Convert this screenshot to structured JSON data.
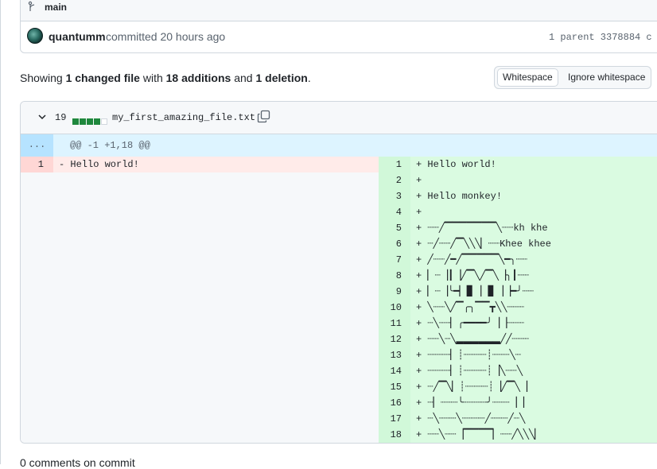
{
  "commit": {
    "branch": "main",
    "author": "quantumm",
    "committed_text": "committed 20 hours ago",
    "parent_info": "1 parent 3378884  c"
  },
  "summary": {
    "prefix": "Showing ",
    "changed": "1 changed file",
    "middle": " with ",
    "additions": "18 additions",
    "and": " and ",
    "deletions": "1 deletion",
    "suffix": "."
  },
  "whitespace": {
    "active_label": "Whitespace",
    "other_label": "Ignore whitespace"
  },
  "file": {
    "changes": "19",
    "diffstat": [
      "add",
      "add",
      "add",
      "add",
      "neu"
    ],
    "name": "my_first_amazing_file.txt",
    "hunk_expand": "...",
    "hunk_header": "@@ -1 +1,18 @@"
  },
  "left_lines": [
    {
      "num": "1",
      "text": "- Hello world!"
    }
  ],
  "right_lines": [
    {
      "num": "1",
      "text": "+ Hello world!"
    },
    {
      "num": "2",
      "text": "+"
    },
    {
      "num": "3",
      "text": "+ Hello monkey!"
    },
    {
      "num": "4",
      "text": "+"
    },
    {
      "num": "5",
      "text": "+ ┈┈╱▔▔▔▔▔▔▔╲┈┈kh khe"
    },
    {
      "num": "6",
      "text": "+ ┈╱┈┈╱▔╲╲╲▏┈┈Khee khee"
    },
    {
      "num": "7",
      "text": "+ ╱┈┈╱━╱▔▔▔▔▔╲━╮┈┈"
    },
    {
      "num": "8",
      "text": "+ ▏┈▕┃▕╱▔╲╱▔╲▕╮┃┈┈"
    },
    {
      "num": "9",
      "text": "+ ▏┈▕╰━▏▊▕▕▋▕▕━╯┈┈"
    },
    {
      "num": "10",
      "text": "+ ╲┈┈╲╱▔╭╮▔▔┳╲╲┈┈┈"
    },
    {
      "num": "11",
      "text": "+ ┈╲┈┈▏╭━━━━╯▕▕┈┈┈"
    },
    {
      "num": "12",
      "text": "+ ┈┈╲┈╲▂▂▂▂▂▂╱╱┈┈┈"
    },
    {
      "num": "13",
      "text": "+ ┈┈┈┈▏┊┈┈┈┈┊┈┈┈╲┈"
    },
    {
      "num": "14",
      "text": "+ ┈┈┈┈▏┊┈┈┈┈┊▕╲┈┈╲"
    },
    {
      "num": "15",
      "text": "+ ┈╱▔╲▏┊┈┈┈┈┊▕╱▔╲▕"
    },
    {
      "num": "16",
      "text": "+ ┈▏┈┈┈╰┈┈┈┈╯┈┈┈▕▕"
    },
    {
      "num": "17",
      "text": "+ ┈╲┈┈┈╲┈┈┈┈╱┈┈┈╱┈╲"
    },
    {
      "num": "18",
      "text": "+ ┈┈╲┈┈▕▔▔▔▔▏┈┈╱╲╲╲▏"
    }
  ],
  "bottom": {
    "text": "0 comments on commit"
  },
  "colors": {
    "addition": "#1f883d",
    "deletion": "#cf222e",
    "hunk_bg": "#ddf4ff"
  }
}
